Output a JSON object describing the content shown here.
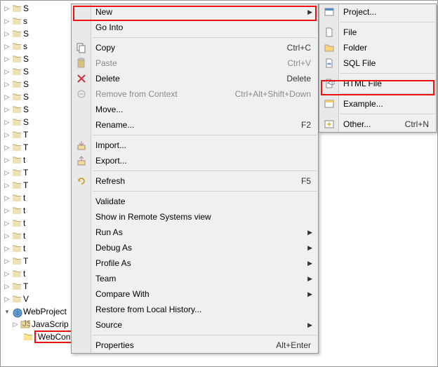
{
  "tree": {
    "items": [
      {
        "label": "S",
        "depth": 0,
        "arrow": ">"
      },
      {
        "label": "s",
        "depth": 0,
        "arrow": ">"
      },
      {
        "label": "S",
        "depth": 0,
        "arrow": ">"
      },
      {
        "label": "s",
        "depth": 0,
        "arrow": ">"
      },
      {
        "label": "S",
        "depth": 0,
        "arrow": ">"
      },
      {
        "label": "S",
        "depth": 0,
        "arrow": ">"
      },
      {
        "label": "S",
        "depth": 0,
        "arrow": ">"
      },
      {
        "label": "S",
        "depth": 0,
        "arrow": ">"
      },
      {
        "label": "S",
        "depth": 0,
        "arrow": ">"
      },
      {
        "label": "S",
        "depth": 0,
        "arrow": ">"
      },
      {
        "label": "T",
        "depth": 0,
        "arrow": ">"
      },
      {
        "label": "T",
        "depth": 0,
        "arrow": ">"
      },
      {
        "label": "t",
        "depth": 0,
        "arrow": ">"
      },
      {
        "label": "T",
        "depth": 0,
        "arrow": ">"
      },
      {
        "label": "T",
        "depth": 0,
        "arrow": ">"
      },
      {
        "label": "t",
        "depth": 0,
        "arrow": ">"
      },
      {
        "label": "t",
        "depth": 0,
        "arrow": ">"
      },
      {
        "label": "t",
        "depth": 0,
        "arrow": ">"
      },
      {
        "label": "t",
        "depth": 0,
        "arrow": ">"
      },
      {
        "label": "t",
        "depth": 0,
        "arrow": ">"
      },
      {
        "label": "T",
        "depth": 0,
        "arrow": ">"
      },
      {
        "label": "t",
        "depth": 0,
        "arrow": ">"
      },
      {
        "label": "T",
        "depth": 0,
        "arrow": ">"
      },
      {
        "label": "V",
        "depth": 0,
        "arrow": ">"
      }
    ],
    "project": {
      "label": "WebProject",
      "arrow": "v"
    },
    "jsres": {
      "label": "JavaScrip",
      "arrow": ">"
    },
    "webcontent": {
      "label": "WebContent"
    }
  },
  "menu": {
    "new": "New",
    "go_into": "Go Into",
    "copy": "Copy",
    "copy_sc": "Ctrl+C",
    "paste": "Paste",
    "paste_sc": "Ctrl+V",
    "delete": "Delete",
    "delete_sc": "Delete",
    "remove_ctx": "Remove from Context",
    "remove_ctx_sc": "Ctrl+Alt+Shift+Down",
    "move": "Move...",
    "rename": "Rename...",
    "rename_sc": "F2",
    "import": "Import...",
    "export": "Export...",
    "refresh": "Refresh",
    "refresh_sc": "F5",
    "validate": "Validate",
    "remote": "Show in Remote Systems view",
    "run_as": "Run As",
    "debug_as": "Debug As",
    "profile_as": "Profile As",
    "team": "Team",
    "compare": "Compare With",
    "restore": "Restore from Local History...",
    "source": "Source",
    "properties": "Properties",
    "properties_sc": "Alt+Enter"
  },
  "submenu": {
    "project": "Project...",
    "file": "File",
    "folder": "Folder",
    "sql": "SQL File",
    "html": "HTML File",
    "example": "Example...",
    "other": "Other...",
    "other_sc": "Ctrl+N"
  }
}
